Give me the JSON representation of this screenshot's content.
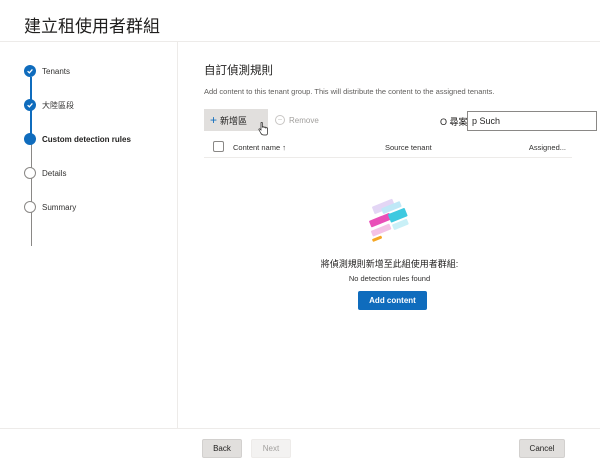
{
  "window": {
    "title": "建立租使用者群組"
  },
  "steps": [
    {
      "label": "Tenants",
      "state": "done"
    },
    {
      "label": "大陸區段",
      "state": "done"
    },
    {
      "label": "Custom detection rules",
      "state": "current"
    },
    {
      "label": "Details",
      "state": "future"
    },
    {
      "label": "Summary",
      "state": "future"
    }
  ],
  "main": {
    "heading": "自訂偵測規則",
    "description": "Add content to this tenant group. This will distribute the content to the assigned tenants."
  },
  "toolbar": {
    "add_label": "新增區",
    "remove_label": "Remove",
    "search_label": "O 尋案",
    "search_value": "p Such"
  },
  "table": {
    "columns": [
      "Content name ↑",
      "Source tenant",
      "Assigned..."
    ]
  },
  "empty_state": {
    "title": "將偵測規則新增至此組使用者群組:",
    "subtitle": "No detection rules found",
    "button": "Add content"
  },
  "footer": {
    "back": "Back",
    "next": "Next",
    "cancel": "Cancel"
  },
  "colors": {
    "accent": "#0f6cbd",
    "border": "#edebe9",
    "muted": "#a19f9d"
  }
}
